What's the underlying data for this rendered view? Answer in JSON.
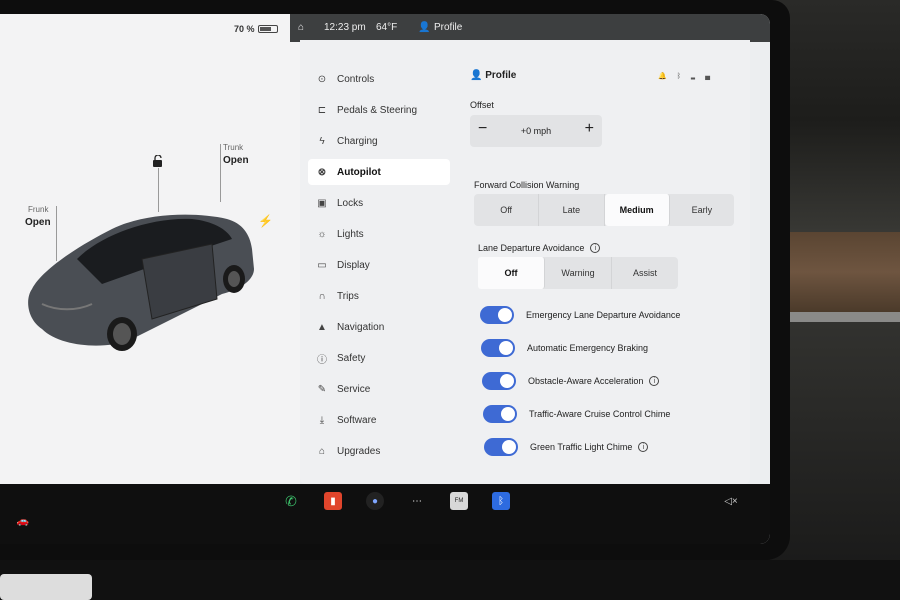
{
  "status": {
    "battery_text": "70 %",
    "battery_level": 0.7,
    "time": "12:23 pm",
    "temp": "64°F",
    "profile": "Profile"
  },
  "car": {
    "trunk_title": "Trunk",
    "trunk_state": "Open",
    "frunk_title": "Frunk",
    "frunk_state": "Open"
  },
  "nav": [
    {
      "label": "Controls",
      "icon": "toggle-icon"
    },
    {
      "label": "Pedals & Steering",
      "icon": "car-icon"
    },
    {
      "label": "Charging",
      "icon": "bolt-icon"
    },
    {
      "label": "Autopilot",
      "icon": "steering-wheel-icon",
      "active": true
    },
    {
      "label": "Locks",
      "icon": "lock-icon"
    },
    {
      "label": "Lights",
      "icon": "sun-icon"
    },
    {
      "label": "Display",
      "icon": "display-icon"
    },
    {
      "label": "Trips",
      "icon": "trips-icon"
    },
    {
      "label": "Navigation",
      "icon": "navigation-arrow-icon"
    },
    {
      "label": "Safety",
      "icon": "info-icon"
    },
    {
      "label": "Service",
      "icon": "wrench-icon"
    },
    {
      "label": "Software",
      "icon": "download-icon"
    },
    {
      "label": "Upgrades",
      "icon": "bag-icon"
    }
  ],
  "autopilot": {
    "profile_label": "Profile",
    "offset_title": "Offset",
    "offset_value": "+0 mph",
    "fcw_title": "Forward Collision Warning",
    "fcw_options": [
      "Off",
      "Late",
      "Medium",
      "Early"
    ],
    "fcw_selected": "Medium",
    "lda_title": "Lane Departure Avoidance",
    "lda_options": [
      "Off",
      "Warning",
      "Assist"
    ],
    "lda_selected": "Off",
    "toggles": [
      {
        "label": "Emergency Lane Departure Avoidance",
        "on": true,
        "info": false
      },
      {
        "label": "Automatic Emergency Braking",
        "on": true,
        "info": false
      },
      {
        "label": "Obstacle-Aware Acceleration",
        "on": true,
        "info": true
      },
      {
        "label": "Traffic-Aware Cruise Control Chime",
        "on": true,
        "info": false
      },
      {
        "label": "Green Traffic Light Chime",
        "on": true,
        "info": true
      }
    ]
  },
  "dock": {
    "items": [
      "phone-icon",
      "media-icon",
      "camera-icon",
      "more-icon",
      "radio-icon",
      "bluetooth-icon"
    ],
    "radio_text": "FM"
  },
  "colors": {
    "toggle_on": "#3e6ad4"
  }
}
